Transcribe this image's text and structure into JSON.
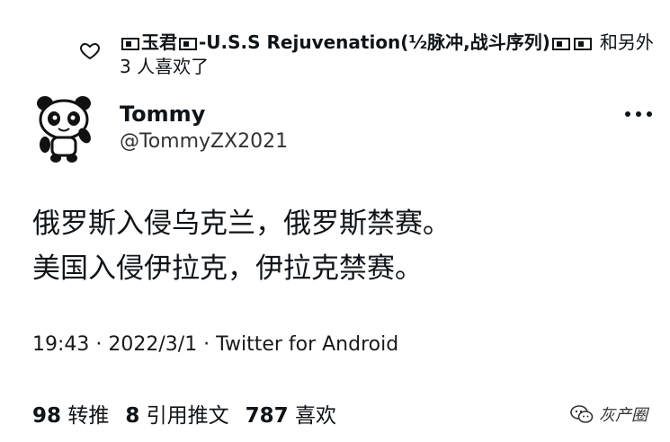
{
  "liked_by": {
    "prefix_name": "玉君",
    "ship_text": "-U.S.S Rejuvenation(½脉冲,战斗序列)",
    "suffix": "和另外 3 人喜欢了"
  },
  "author": {
    "name": "Tommy",
    "handle": "@TommyZX2021"
  },
  "tweet": {
    "line1": "俄罗斯入侵乌克兰，俄罗斯禁赛。",
    "line2": "美国入侵伊拉克，伊拉克禁赛。"
  },
  "meta": {
    "text": "19:43 · 2022/3/1 · Twitter for Android"
  },
  "stats": {
    "retweets_count": "98",
    "retweets_label": "转推",
    "quotes_count": "8",
    "quotes_label": "引用推文",
    "likes_count": "787",
    "likes_label": "喜欢"
  },
  "watermark": {
    "text": "灰产圈"
  }
}
